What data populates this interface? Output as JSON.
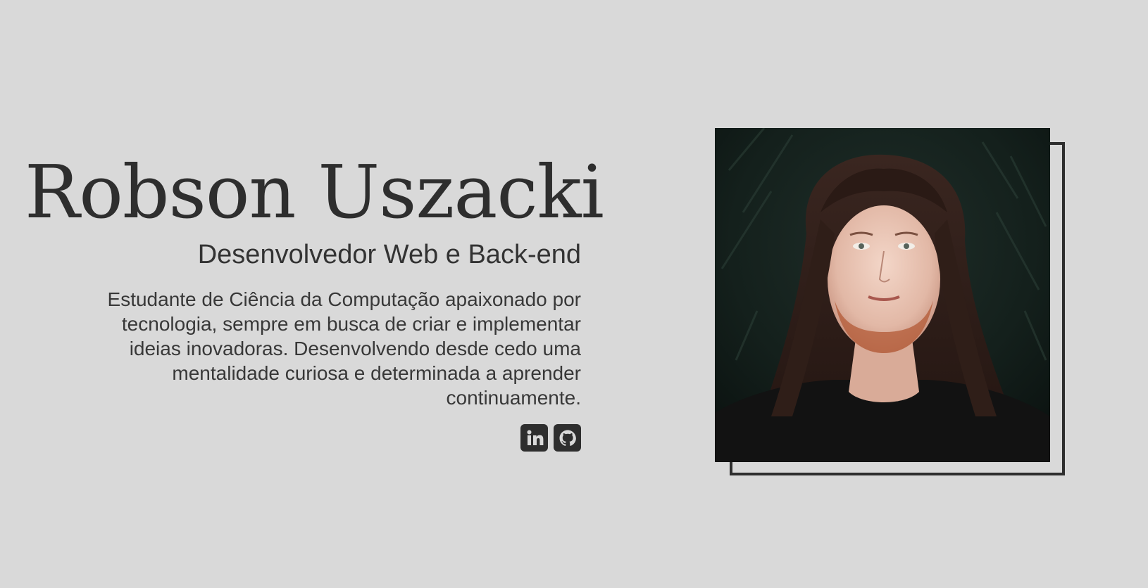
{
  "profile": {
    "name": "Robson Uszacki",
    "role": "Desenvolvedor Web e Back-end",
    "bio_lines": [
      "Estudante de Ciência da Computação apaixonado por",
      "tecnologia, sempre em busca de criar e implementar",
      "ideias inovadoras. Desenvolvendo desde cedo uma",
      "mentalidade curiosa e determinada a aprender",
      "continuamente."
    ]
  },
  "social": [
    {
      "name": "LinkedIn",
      "icon": "linkedin-icon"
    },
    {
      "name": "GitHub",
      "icon": "github-icon"
    }
  ],
  "colors": {
    "background": "#d9d9d9",
    "text": "#2e2e2e",
    "frame": "#2e2e2e"
  },
  "photo": {
    "icon": "portrait-photo",
    "subject": "portrait"
  }
}
